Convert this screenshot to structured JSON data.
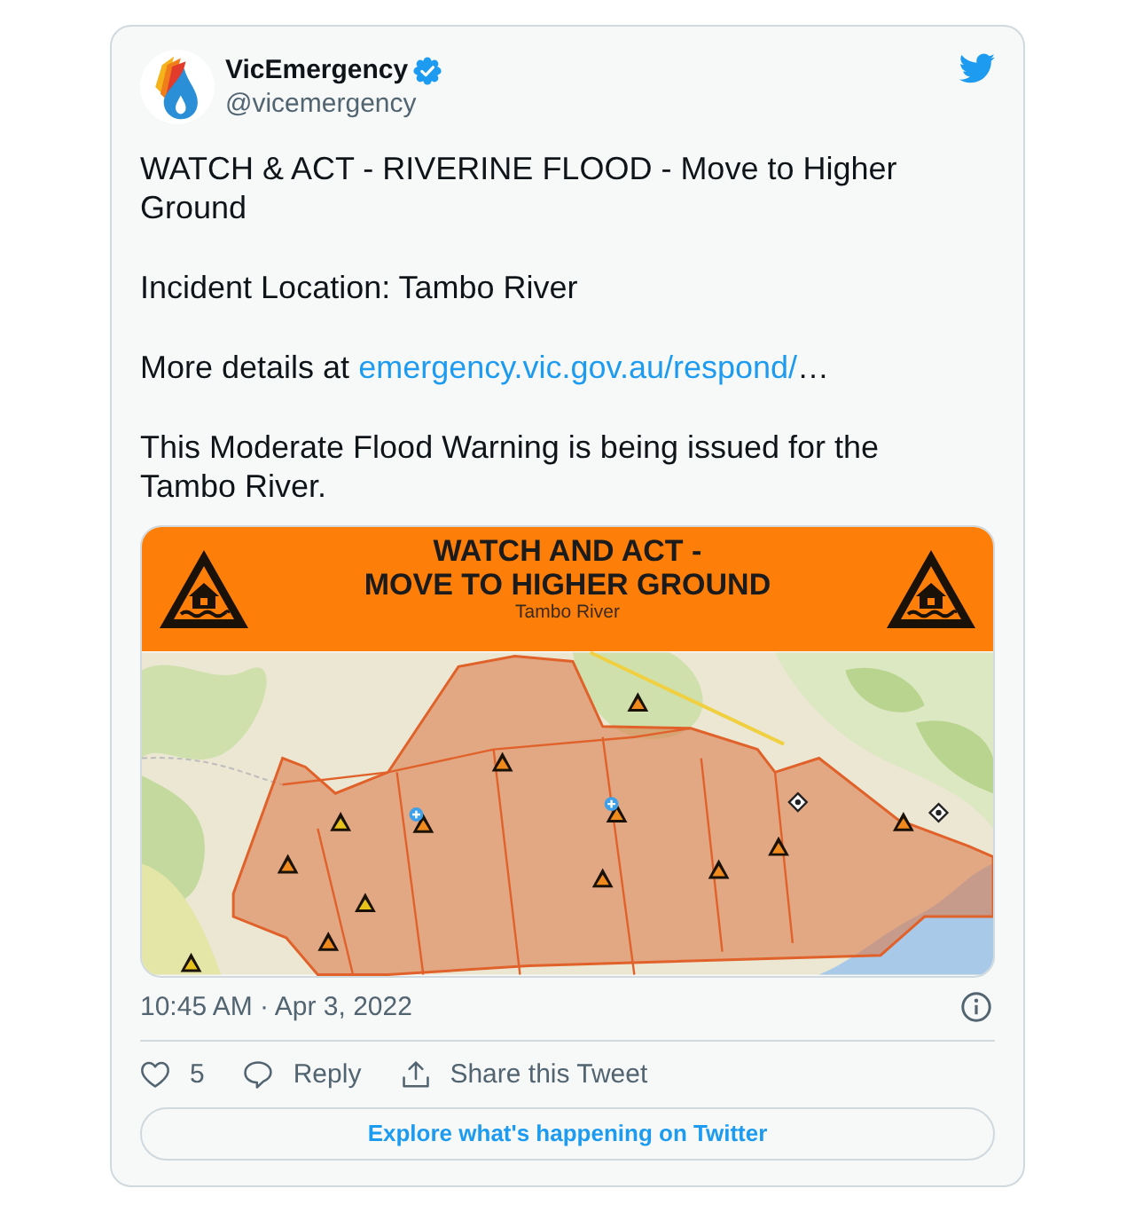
{
  "tweet": {
    "author": {
      "name": "VicEmergency",
      "verified": true,
      "handle": "@vicemergency"
    },
    "paragraphs": [
      {
        "text": "WATCH & ACT - RIVERINE FLOOD - Move to Higher Ground"
      },
      {
        "text": "Incident Location: Tambo River"
      },
      {
        "text": "More details at ",
        "link": "emergency.vic.gov.au/respond/",
        "after": "…"
      },
      {
        "text": "This Moderate Flood Warning is being issued for the Tambo River."
      }
    ],
    "media": {
      "banner": {
        "title_lines": [
          "WATCH AND ACT -",
          "MOVE TO HIGHER GROUND"
        ],
        "subtitle": "Tambo River"
      }
    },
    "timestamp": "10:45 AM · Apr 3, 2022",
    "actions": [
      {
        "kind": "like",
        "label": "5",
        "liked": false
      },
      {
        "kind": "reply",
        "label": "Reply"
      },
      {
        "kind": "share",
        "label": "Share this Tweet"
      }
    ],
    "explore_button": "Explore what's happening on Twitter"
  }
}
